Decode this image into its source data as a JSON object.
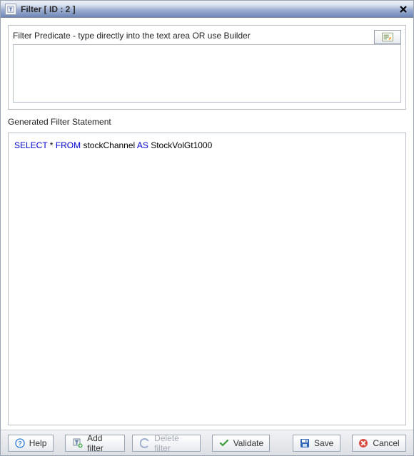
{
  "window": {
    "title": "Filter [ ID : 2 ]"
  },
  "predicate": {
    "label": "Filter Predicate - type directly into the text area OR use Builder",
    "value": ""
  },
  "statement": {
    "label": "Generated Filter Statement",
    "tokens": {
      "select": "SELECT",
      "star_from": " * ",
      "from": "FROM",
      "table": " stockChannel ",
      "as": "AS",
      "alias": " StockVolGt1000"
    }
  },
  "buttons": {
    "help": "Help",
    "add_filter": "Add filter",
    "delete_filter": "Delete filter",
    "validate": "Validate",
    "save": "Save",
    "cancel": "Cancel"
  }
}
